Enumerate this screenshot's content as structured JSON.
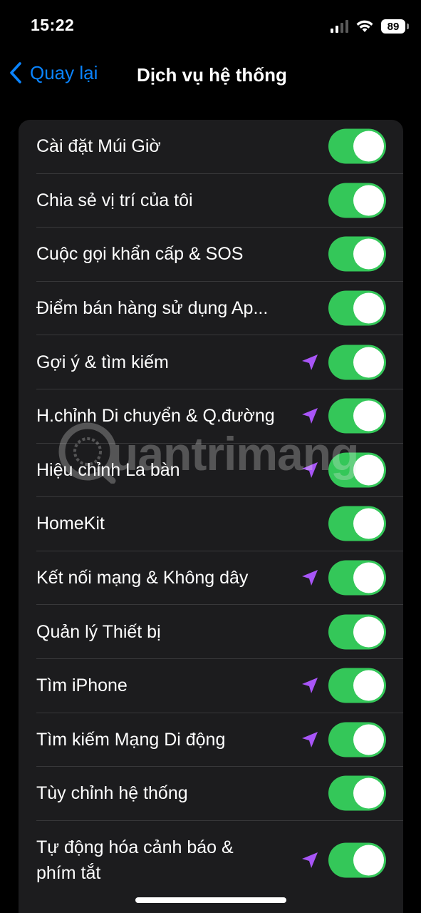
{
  "status_bar": {
    "time": "15:22",
    "battery": "89"
  },
  "nav": {
    "back_label": "Quay lại",
    "title": "Dịch vụ hệ thống"
  },
  "watermark": {
    "text": "uantrimang"
  },
  "colors": {
    "accent": "#0a84ff",
    "toggle_on": "#34c759",
    "location": "#a855f7",
    "cell_bg": "#1c1c1e"
  },
  "rows": [
    {
      "label": "Cài đặt Múi Giờ",
      "toggle_on": true,
      "location_icon": false
    },
    {
      "label": "Chia sẻ vị trí của tôi",
      "toggle_on": true,
      "location_icon": false
    },
    {
      "label": "Cuộc gọi khẩn cấp & SOS",
      "toggle_on": true,
      "location_icon": false
    },
    {
      "label": "Điểm bán hàng sử dụng Ap...",
      "toggle_on": true,
      "location_icon": false
    },
    {
      "label": "Gợi ý & tìm kiếm",
      "toggle_on": true,
      "location_icon": true
    },
    {
      "label": "H.chỉnh Di chuyển & Q.đường",
      "toggle_on": true,
      "location_icon": true
    },
    {
      "label": "Hiệu chỉnh La bàn",
      "toggle_on": true,
      "location_icon": true
    },
    {
      "label": "HomeKit",
      "toggle_on": true,
      "location_icon": false
    },
    {
      "label": "Kết nối mạng & Không dây",
      "toggle_on": true,
      "location_icon": true
    },
    {
      "label": "Quản lý Thiết bị",
      "toggle_on": true,
      "location_icon": false
    },
    {
      "label": "Tìm iPhone",
      "toggle_on": true,
      "location_icon": true
    },
    {
      "label": "Tìm kiếm Mạng Di động",
      "toggle_on": true,
      "location_icon": true
    },
    {
      "label": "Tùy chỉnh hệ thống",
      "toggle_on": true,
      "location_icon": false
    },
    {
      "label": "Tự động hóa cảnh báo &\nphím tắt",
      "toggle_on": true,
      "location_icon": true
    }
  ]
}
